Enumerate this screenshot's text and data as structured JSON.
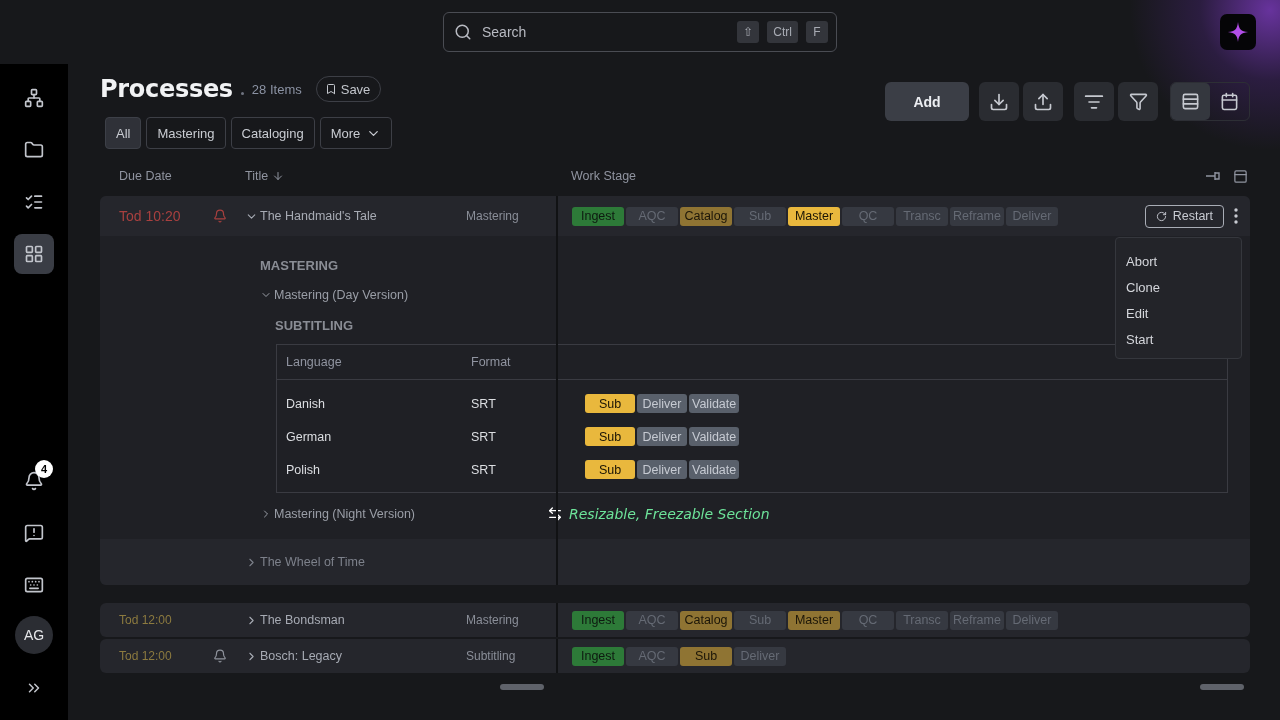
{
  "search": {
    "placeholder": "Search",
    "keys": [
      "⇧",
      "Ctrl",
      "F"
    ]
  },
  "sidebar": {
    "items": [
      {
        "kind": "nodes",
        "selected": false
      },
      {
        "kind": "folder",
        "selected": false
      },
      {
        "kind": "tasks",
        "selected": false
      },
      {
        "kind": "apps",
        "selected": true
      }
    ],
    "notification_count": "4",
    "avatar": "AG"
  },
  "header": {
    "title": "Processes",
    "count": "28 Items",
    "save": "Save"
  },
  "filters": [
    {
      "label": "All",
      "selected": true
    },
    {
      "label": "Mastering",
      "selected": false
    },
    {
      "label": "Cataloging",
      "selected": false
    }
  ],
  "more_filter": "More",
  "toolbar": {
    "add": "Add",
    "views": [
      {
        "kind": "list",
        "selected": true
      },
      {
        "kind": "calendar",
        "selected": false
      }
    ]
  },
  "columns": {
    "due": "Due Date",
    "title": "Title",
    "stage": "Work Stage"
  },
  "groups": [
    {
      "rows": [
        {
          "due": "Tod 10:20",
          "overdue": true,
          "alert": true,
          "expanded": true,
          "title": "The Handmaid's Tale",
          "type": "Mastering",
          "stages": [
            {
              "label": "Ingest",
              "kind": "done"
            },
            {
              "label": "AQC",
              "kind": "pending"
            },
            {
              "label": "Catalog",
              "kind": "partial"
            },
            {
              "label": "Sub",
              "kind": "pending"
            },
            {
              "label": "Master",
              "kind": "active"
            },
            {
              "label": "QC",
              "kind": "pending"
            },
            {
              "label": "Transc",
              "kind": "pending"
            },
            {
              "label": "Reframe",
              "kind": "pending"
            },
            {
              "label": "Deliver",
              "kind": "pending"
            }
          ],
          "action": "Restart",
          "menu": [
            "Abort",
            "Clone",
            "Edit",
            "Start"
          ],
          "details": {
            "section": "MASTERING",
            "items": [
              {
                "title": "Mastering (Day Version)",
                "expanded": true,
                "section": "SUBTITLING",
                "table": {
                  "columns": [
                    "Language",
                    "Format"
                  ],
                  "rows": [
                    {
                      "language": "Danish",
                      "format": "SRT",
                      "stages": [
                        {
                          "label": "Sub",
                          "kind": "active"
                        },
                        {
                          "label": "Deliver",
                          "kind": "pending"
                        },
                        {
                          "label": "Validate",
                          "kind": "pending"
                        }
                      ]
                    },
                    {
                      "language": "German",
                      "format": "SRT",
                      "stages": [
                        {
                          "label": "Sub",
                          "kind": "active"
                        },
                        {
                          "label": "Deliver",
                          "kind": "pending"
                        },
                        {
                          "label": "Validate",
                          "kind": "pending"
                        }
                      ]
                    },
                    {
                      "language": "Polish",
                      "format": "SRT",
                      "stages": [
                        {
                          "label": "Sub",
                          "kind": "active"
                        },
                        {
                          "label": "Deliver",
                          "kind": "pending"
                        },
                        {
                          "label": "Validate",
                          "kind": "pending"
                        }
                      ]
                    }
                  ]
                }
              },
              {
                "title": "Mastering (Night Version)",
                "expanded": false,
                "annotation": "Resizable, Freezable Section"
              }
            ]
          }
        },
        {
          "expanded": false,
          "alert": false,
          "title": "The Wheel of Time"
        }
      ]
    },
    {
      "rows": [
        {
          "due": "Tod 12:00",
          "overdue": false,
          "alert": false,
          "expanded": false,
          "title": "The Bondsman",
          "type": "Mastering",
          "stages": [
            {
              "label": "Ingest",
              "kind": "done"
            },
            {
              "label": "AQC",
              "kind": "pending"
            },
            {
              "label": "Catalog",
              "kind": "partial"
            },
            {
              "label": "Sub",
              "kind": "pending"
            },
            {
              "label": "Master",
              "kind": "partial"
            },
            {
              "label": "QC",
              "kind": "pending"
            },
            {
              "label": "Transc",
              "kind": "pending"
            },
            {
              "label": "Reframe",
              "kind": "pending"
            },
            {
              "label": "Deliver",
              "kind": "pending"
            }
          ]
        }
      ]
    },
    {
      "rows": [
        {
          "due": "Tod 12:00",
          "overdue": false,
          "alert": true,
          "expanded": false,
          "title": "Bosch: Legacy",
          "type": "Subtitling",
          "stages": [
            {
              "label": "Ingest",
              "kind": "done"
            },
            {
              "label": "AQC",
              "kind": "pending"
            },
            {
              "label": "Sub",
              "kind": "partial"
            },
            {
              "label": "Deliver",
              "kind": "pending"
            }
          ]
        }
      ]
    }
  ]
}
